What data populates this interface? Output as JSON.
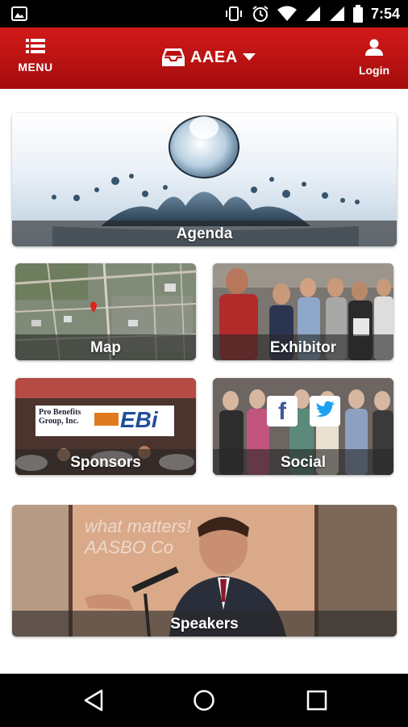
{
  "status_bar": {
    "time": "7:54"
  },
  "app_bar": {
    "menu_label": "MENU",
    "title": "AAEA",
    "login_label": "Login"
  },
  "tiles": {
    "agenda": {
      "label": "Agenda"
    },
    "map": {
      "label": "Map"
    },
    "exhibitor": {
      "label": "Exhibitor"
    },
    "sponsors": {
      "label": "Sponsors",
      "logo1_text": "Pro Benefits Group, Inc.",
      "logo2_text": "EBi"
    },
    "social": {
      "label": "Social"
    },
    "speakers": {
      "label": "Speakers",
      "slide_text": "what matters! AASBO Co"
    }
  },
  "colors": {
    "brand_red": "#c01313",
    "caption_overlay": "#282828"
  },
  "icons": [
    "photo-icon",
    "vibrate-icon",
    "alarm-icon",
    "wifi-icon",
    "signal-icon",
    "battery-icon",
    "menu-icon",
    "inbox-icon",
    "chevron-down-icon",
    "person-icon",
    "facebook-icon",
    "twitter-icon",
    "back-icon",
    "home-icon",
    "recents-icon"
  ]
}
